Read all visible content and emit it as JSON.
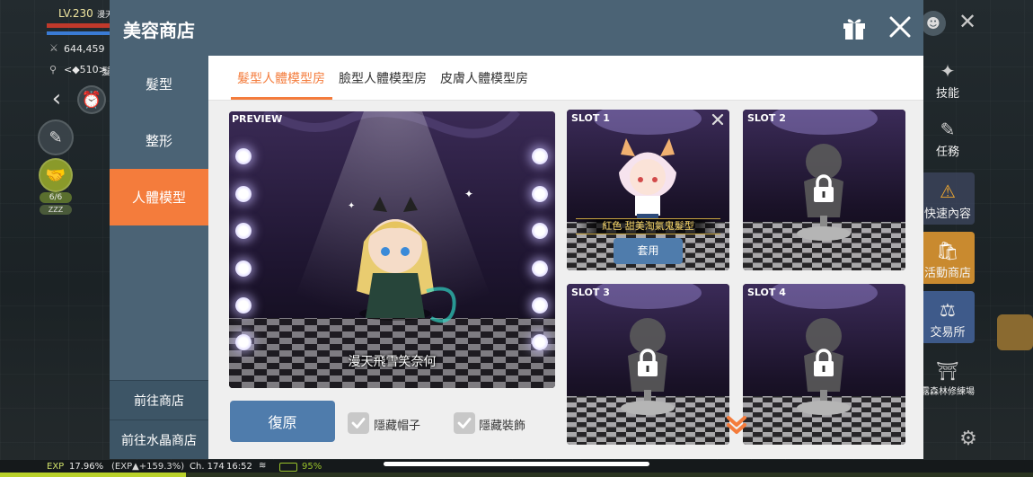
{
  "hud": {
    "level": "LV.230",
    "name": "漫天",
    "power": "644,459",
    "map": "<◆510>",
    "map_suffix": "髮",
    "buff_count": "6/6",
    "zzz": "ZZZ",
    "exp_label": "EXP",
    "exp_value": "17.96%",
    "exp_gain": "(EXP▲+159.3%)",
    "channel": "Ch. 174",
    "time": "16:52",
    "battery": "95%"
  },
  "right_menu": [
    {
      "label": "技能",
      "icon": "skill-icon"
    },
    {
      "label": "任務",
      "icon": "quest-icon"
    },
    {
      "label": "快速內容",
      "icon": "warning-icon"
    },
    {
      "label": "活動商店",
      "icon": "event-shop-icon"
    },
    {
      "label": "交易所",
      "icon": "scale-icon"
    },
    {
      "label": "露森林修練場",
      "icon": "training-icon"
    }
  ],
  "modal": {
    "title": "美容商店"
  },
  "sidebar": {
    "items": [
      {
        "label": "髮型"
      },
      {
        "label": "整形"
      },
      {
        "label": "人體模型"
      }
    ],
    "bottom": [
      {
        "label": "前往商店"
      },
      {
        "label": "前往水晶商店"
      }
    ]
  },
  "tabs": [
    {
      "label": "髮型人體模型房"
    },
    {
      "label": "臉型人體模型房"
    },
    {
      "label": "皮膚人體模型房"
    }
  ],
  "preview": {
    "label": "PREVIEW",
    "character_name": "漫天飛雪笑奈何"
  },
  "slots": [
    {
      "label": "SLOT 1",
      "item_name": "紅色 甜美淘氣鬼髮型",
      "apply_label": "套用"
    },
    {
      "label": "SLOT 2"
    },
    {
      "label": "SLOT 3"
    },
    {
      "label": "SLOT 4"
    }
  ],
  "actions": {
    "restore_label": "復原",
    "hide_hat_label": "隱藏帽子",
    "hide_equip_label": "隱藏裝飾"
  },
  "colors": {
    "header": "#4b6375",
    "accent": "#f47c3c",
    "button": "#4f7cac"
  }
}
